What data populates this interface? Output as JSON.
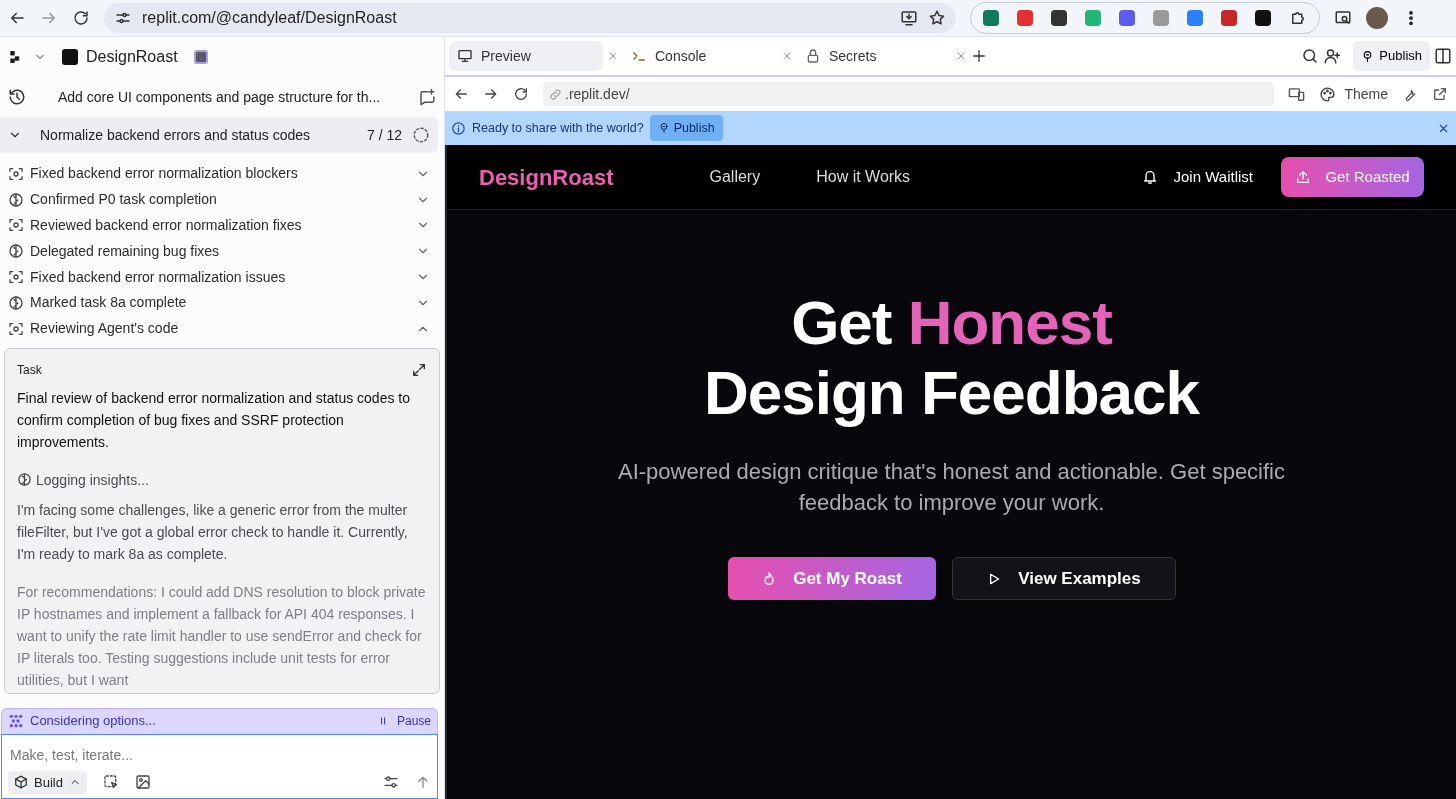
{
  "browser": {
    "url": "replit.com/@candyleaf/DesignRoast"
  },
  "workspace": {
    "project_name": "DesignRoast",
    "chat_title": "Add core UI components and page structure for th...",
    "progress": {
      "title": "Normalize backend errors and status codes",
      "count": "7 / 12",
      "expanded": true
    },
    "steps": [
      {
        "label": "Fixed backend error normalization blockers",
        "kind": "review",
        "expanded": false
      },
      {
        "label": "Confirmed P0 task completion",
        "kind": "thinking",
        "expanded": false
      },
      {
        "label": "Reviewed backend error normalization fixes",
        "kind": "review",
        "expanded": false
      },
      {
        "label": "Delegated remaining bug fixes",
        "kind": "thinking",
        "expanded": false
      },
      {
        "label": "Fixed backend error normalization issues",
        "kind": "review",
        "expanded": false
      },
      {
        "label": "Marked task 8a complete",
        "kind": "thinking",
        "expanded": false
      },
      {
        "label": "Reviewing Agent's code",
        "kind": "review",
        "expanded": true
      }
    ],
    "task": {
      "label": "Task",
      "text": "Final review of backend error normalization and status codes to confirm completion of bug fixes and SSRF protection improvements.",
      "insight": "Logging insights...",
      "paragraphs": [
        "I'm facing some challenges, like a generic error from the multer fileFilter, but I've got a global error check to handle it. Currently, I'm ready to mark 8a as complete.",
        "For recommendations: I could add DNS resolution to block private IP hostnames and implement a fallback for API 404 responses. I want to unify the rate limit handler to use sendError and check for IP literals too. Testing suggestions include unit tests for error utilities, but I want"
      ]
    },
    "status": {
      "text": "Considering options...",
      "pause": "Pause"
    },
    "composer": {
      "placeholder": "Make, test, iterate...",
      "mode": "Build"
    }
  },
  "preview": {
    "tabs": [
      {
        "label": "Preview",
        "kind": "preview",
        "selected": true
      },
      {
        "label": "Console",
        "kind": "console",
        "selected": false
      },
      {
        "label": "Secrets",
        "kind": "secrets",
        "selected": false
      }
    ],
    "publish": "Publish",
    "url": ".replit.dev/",
    "theme": "Theme",
    "banner": {
      "text": "Ready to share with the world?",
      "button": "Publish"
    },
    "site": {
      "brand": "DesignRoast",
      "nav": [
        "Gallery",
        "How it Works"
      ],
      "waitlist": "Join Waitlist",
      "cta": "Get Roasted",
      "headline_start": "Get",
      "headline_accent": "Honest",
      "headline_end": "Design Feedback",
      "subtitle": "AI-powered design critique that's honest and actionable. Get specific feedback to improve your work.",
      "buttons": [
        {
          "label": "Get My Roast",
          "kind": "primary"
        },
        {
          "label": "View Examples",
          "kind": "secondary"
        }
      ]
    }
  }
}
